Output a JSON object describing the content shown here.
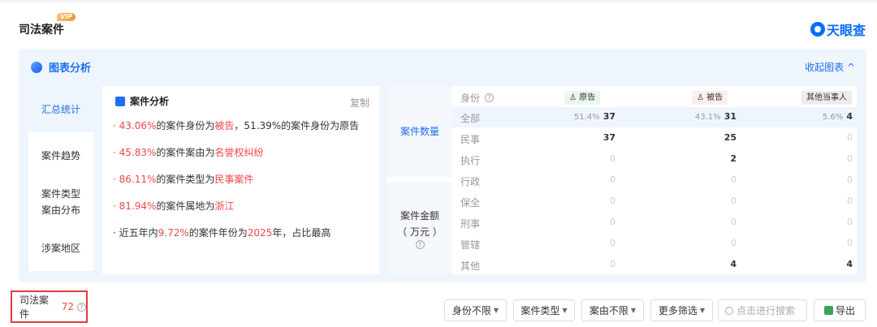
{
  "header": {
    "title": "司法案件",
    "vip": "VIP",
    "brand": "天眼查"
  },
  "panel": {
    "title": "图表分析",
    "collapse_label": "收起图表 ^",
    "nav": [
      {
        "label": "汇总统计"
      },
      {
        "label": "案件趋势"
      },
      {
        "label": "案件类型 案由分布"
      },
      {
        "label": "涉案地区"
      }
    ],
    "analysis": {
      "title": "案件分析",
      "copy_label": "复制",
      "lines": [
        {
          "a": "· 43.06%",
          "b": "的案件身份为",
          "c": "被告",
          "d": "，51.39%的案件身份为原告"
        },
        {
          "a": "· 45.83%",
          "b": "的案件案由为",
          "c": "名誉权纠纷",
          "d": ""
        },
        {
          "a": "· 86.11%",
          "b": "的案件类型为",
          "c": "民事案件",
          "d": ""
        },
        {
          "a": "· 81.94%",
          "b": "的案件属地为",
          "c": "浙江",
          "d": ""
        },
        {
          "a": "· 近五年内",
          "b": "9.72%",
          "c": "的案件年份为",
          "d": "2025",
          "e": "年，占比最高"
        }
      ]
    },
    "table": {
      "group1": "案件数量",
      "group2_line1": "案件金额",
      "group2_line2": "（ 万元 ）",
      "role_header": "身份",
      "col_plaintiff": "原告",
      "col_defendant": "被告",
      "col_others": "其他当事人",
      "rows": [
        {
          "label": "全部",
          "p_pct": "51.4%",
          "p": "37",
          "d_pct": "43.1%",
          "d": "31",
          "o_pct": "5.6%",
          "o": "4"
        },
        {
          "label": "民事",
          "p": "37",
          "d": "25",
          "o": "0"
        },
        {
          "label": "执行",
          "p": "0",
          "d": "2",
          "o": "0"
        },
        {
          "label": "行政",
          "p": "0",
          "d": "0",
          "o": "0"
        },
        {
          "label": "保全",
          "p": "0",
          "d": "0",
          "o": "0"
        },
        {
          "label": "刑事",
          "p": "0",
          "d": "0",
          "o": "0"
        },
        {
          "label": "管辖",
          "p": "0",
          "d": "0",
          "o": "0"
        },
        {
          "label": "其他",
          "p": "0",
          "d": "4",
          "o": "4"
        }
      ]
    }
  },
  "footer": {
    "label": "司法案件",
    "count": "72",
    "filters": [
      "身份不限",
      "案件类型",
      "案由不限",
      "更多筛选"
    ],
    "search_placeholder": "点击进行搜索",
    "export_label": "导出"
  }
}
